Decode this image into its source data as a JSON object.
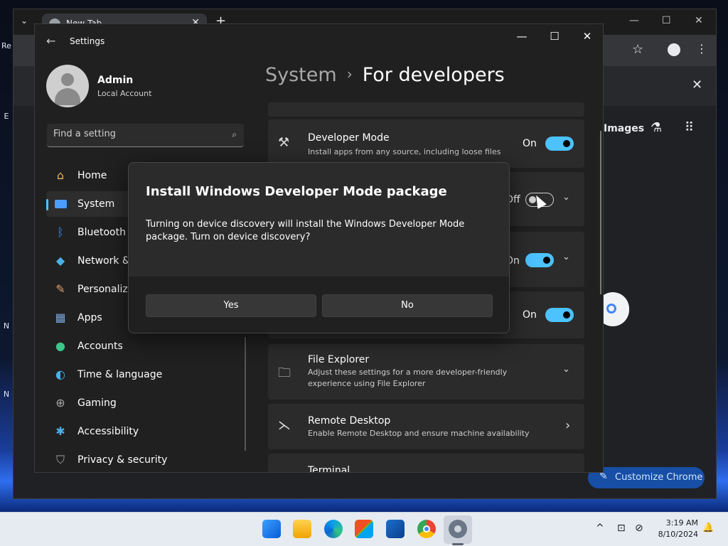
{
  "desktop": {
    "glyphs": [
      "Re",
      "E",
      "N",
      "N"
    ]
  },
  "chrome": {
    "tab_title": "New Tab",
    "tab_close": "✕",
    "new_tab": "+",
    "tab_search": "⌄",
    "minimize": "—",
    "maximize": "☐",
    "close": "✕",
    "star": "☆",
    "menu": "⋮",
    "infobar_close": "✕",
    "images_link": "Images",
    "labs_icon": "⚗",
    "apps_icon": "⠿",
    "customize_label": "Customize Chrome",
    "customize_icon": "✎"
  },
  "settings": {
    "app_title": "Settings",
    "back": "←",
    "minimize": "—",
    "maximize": "☐",
    "close": "✕",
    "user": {
      "name": "Admin",
      "type": "Local Account"
    },
    "search": {
      "placeholder": "Find a setting",
      "value": ""
    },
    "nav": [
      {
        "label": "Home",
        "icon": "home-icon",
        "active": false
      },
      {
        "label": "System",
        "icon": "system-icon",
        "active": true
      },
      {
        "label": "Bluetooth & devices",
        "icon": "bluetooth-icon",
        "active": false
      },
      {
        "label": "Network & internet",
        "icon": "network-icon",
        "active": false
      },
      {
        "label": "Personalization",
        "icon": "brush-icon",
        "active": false
      },
      {
        "label": "Apps",
        "icon": "apps-icon",
        "active": false
      },
      {
        "label": "Accounts",
        "icon": "accounts-icon",
        "active": false
      },
      {
        "label": "Time & language",
        "icon": "globe-icon",
        "active": false
      },
      {
        "label": "Gaming",
        "icon": "gamepad-icon",
        "active": false
      },
      {
        "label": "Accessibility",
        "icon": "accessibility-icon",
        "active": false
      },
      {
        "label": "Privacy & security",
        "icon": "shield-icon",
        "active": false
      }
    ],
    "breadcrumb": {
      "parent": "System",
      "separator": "›",
      "current": "For developers"
    },
    "cards": {
      "developer_mode": {
        "title": "Developer Mode",
        "desc": "Install apps from any source, including loose files",
        "state": "On"
      },
      "device_portal": {
        "state": "Off"
      },
      "device_discovery": {
        "state": "On"
      },
      "card4": {
        "state": "On"
      },
      "file_explorer": {
        "title": "File Explorer",
        "desc": "Adjust these settings for a more developer-friendly experience using File Explorer"
      },
      "remote_desktop": {
        "title": "Remote Desktop",
        "desc": "Enable Remote Desktop and ensure machine availability"
      },
      "terminal": {
        "title": "Terminal"
      }
    },
    "chevron_down": "⌄",
    "chevron_right": "›"
  },
  "dialog": {
    "title": "Install Windows Developer Mode package",
    "body": "Turning on device discovery will install the Windows Developer Mode package. Turn on device discovery?",
    "yes_label": "Yes",
    "no_label": "No"
  },
  "taskbar": {
    "time": "3:19 AM",
    "date": "8/10/2024",
    "tray_chevron": "^",
    "network_icon": "⊡",
    "volume_icon": "⊘",
    "bell_icon": "🔔"
  },
  "colors": {
    "accent": "#4cc2ff",
    "dialog_bg": "#2b2b2b",
    "settings_bg": "#202020"
  }
}
